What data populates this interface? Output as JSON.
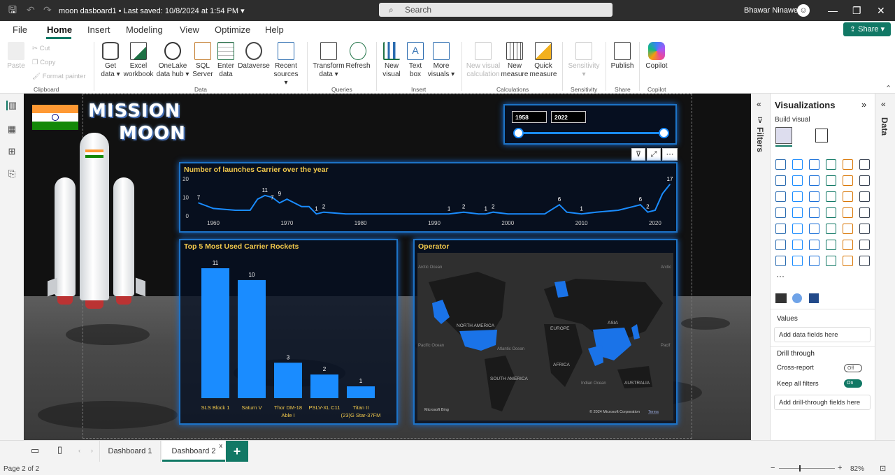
{
  "titlebar": {
    "filename": "moon dasboard1",
    "saved": "Last saved: 10/8/2024 at 1:54 PM",
    "search_placeholder": "Search",
    "user": "Bhawar Ninawe"
  },
  "menu": {
    "items": [
      "File",
      "Home",
      "Insert",
      "Modeling",
      "View",
      "Optimize",
      "Help"
    ],
    "active": "Home",
    "share": "Share"
  },
  "ribbon": {
    "clipboard": {
      "paste": "Paste",
      "cut": "Cut",
      "copy": "Copy",
      "format_painter": "Format painter",
      "group": "Clipboard"
    },
    "data": {
      "get_data": "Get data",
      "excel": "Excel workbook",
      "onelake": "OneLake data hub",
      "sql": "SQL Server",
      "enter": "Enter data",
      "dataverse": "Dataverse",
      "recent": "Recent sources",
      "group": "Data"
    },
    "queries": {
      "transform": "Transform data",
      "refresh": "Refresh",
      "group": "Queries"
    },
    "insert": {
      "new_visual": "New visual",
      "text_box": "Text box",
      "more_visuals": "More visuals",
      "group": "Insert"
    },
    "calculations": {
      "new_visual_calc": "New visual calculation",
      "new_measure": "New measure",
      "quick_measure": "Quick measure",
      "group": "Calculations"
    },
    "sensitivity": {
      "label": "Sensitivity",
      "group": "Sensitivity"
    },
    "share": {
      "publish": "Publish",
      "group": "Share"
    },
    "copilot": {
      "label": "Copilot",
      "group": "Copilot"
    }
  },
  "dashboard": {
    "title_line1": "MISSION",
    "title_line2": "MOON",
    "slider": {
      "start": "1958",
      "end": "2022"
    },
    "colors": {
      "accent": "#1a8cff",
      "title_gold": "#f2c94c",
      "panel_border": "#1d73c6"
    }
  },
  "chart_data": [
    {
      "type": "line",
      "title": "Number of launches Carrier over the year",
      "x": [
        1958,
        1960,
        1963,
        1965,
        1966,
        1967,
        1968,
        1969,
        1970,
        1972,
        1973,
        1974,
        1975,
        1978,
        1980,
        1985,
        1990,
        1992,
        1994,
        1996,
        1997,
        1998,
        2000,
        2003,
        2005,
        2007,
        2008,
        2010,
        2012,
        2015,
        2017,
        2018,
        2019,
        2020,
        2021,
        2022
      ],
      "values": [
        7,
        4,
        3,
        3,
        9,
        11,
        10,
        7,
        9,
        5,
        5,
        1,
        2,
        1,
        1,
        1,
        1,
        1,
        2,
        1,
        1,
        2,
        1,
        1,
        1,
        6,
        2,
        1,
        2,
        3,
        5,
        6,
        2,
        3,
        12,
        17
      ],
      "ylim": [
        0,
        20
      ],
      "yticks": [
        "0",
        "10",
        "20"
      ],
      "xticks": [
        "1960",
        "1970",
        "1980",
        "1990",
        "2000",
        "2010",
        "2020"
      ],
      "data_labels": [
        {
          "year": 1958,
          "value": "7"
        },
        {
          "year": 1967,
          "value": "11"
        },
        {
          "year": 1968,
          "value": "7"
        },
        {
          "year": 1969,
          "value": "9"
        },
        {
          "year": 1974,
          "value": "1"
        },
        {
          "year": 1975,
          "value": "2"
        },
        {
          "year": 1992,
          "value": "1"
        },
        {
          "year": 1994,
          "value": "2"
        },
        {
          "year": 1997,
          "value": "1"
        },
        {
          "year": 1998,
          "value": "2"
        },
        {
          "year": 2007,
          "value": "6"
        },
        {
          "year": 2010,
          "value": "1"
        },
        {
          "year": 2018,
          "value": "6"
        },
        {
          "year": 2019,
          "value": "2"
        },
        {
          "year": 2022,
          "value": "17"
        }
      ]
    },
    {
      "type": "bar",
      "title": "Top 5 Most Used Carrier Rockets",
      "categories": [
        "SLS Block 1",
        "Saturn V",
        "Thor DM-18 Able I",
        "PSLV-XL C11",
        "Titan II (23)G Star-37FM"
      ],
      "values": [
        11,
        10,
        3,
        2,
        1
      ],
      "ylim": [
        0,
        11
      ]
    }
  ],
  "map": {
    "title": "Operator",
    "labels": [
      "Arctic Ocean",
      "Arctic",
      "NORTH AMERICA",
      "EUROPE",
      "ASIA",
      "Pacific Ocean",
      "Atlantic Ocean",
      "Pacif",
      "AFRICA",
      "SOUTH AMERICA",
      "Indian Ocean",
      "AUSTRALIA"
    ],
    "attribution": "© 2024 Microsoft Corporation",
    "terms": "Terms",
    "brand": "Microsoft Bing"
  },
  "panes": {
    "filters": "Filters",
    "data": "Data",
    "visualizations": "Visualizations",
    "build_visual": "Build visual",
    "values_label": "Values",
    "values_placeholder": "Add data fields here",
    "drill_through": "Drill through",
    "cross_report": "Cross-report",
    "cross_report_state": "Off",
    "keep_filters": "Keep all filters",
    "keep_filters_state": "On",
    "drill_placeholder": "Add drill-through fields here"
  },
  "tabs": {
    "items": [
      "Dashboard 1",
      "Dashboard 2"
    ],
    "active": "Dashboard 2"
  },
  "status": {
    "page": "Page 2 of 2",
    "zoom": "82%"
  }
}
